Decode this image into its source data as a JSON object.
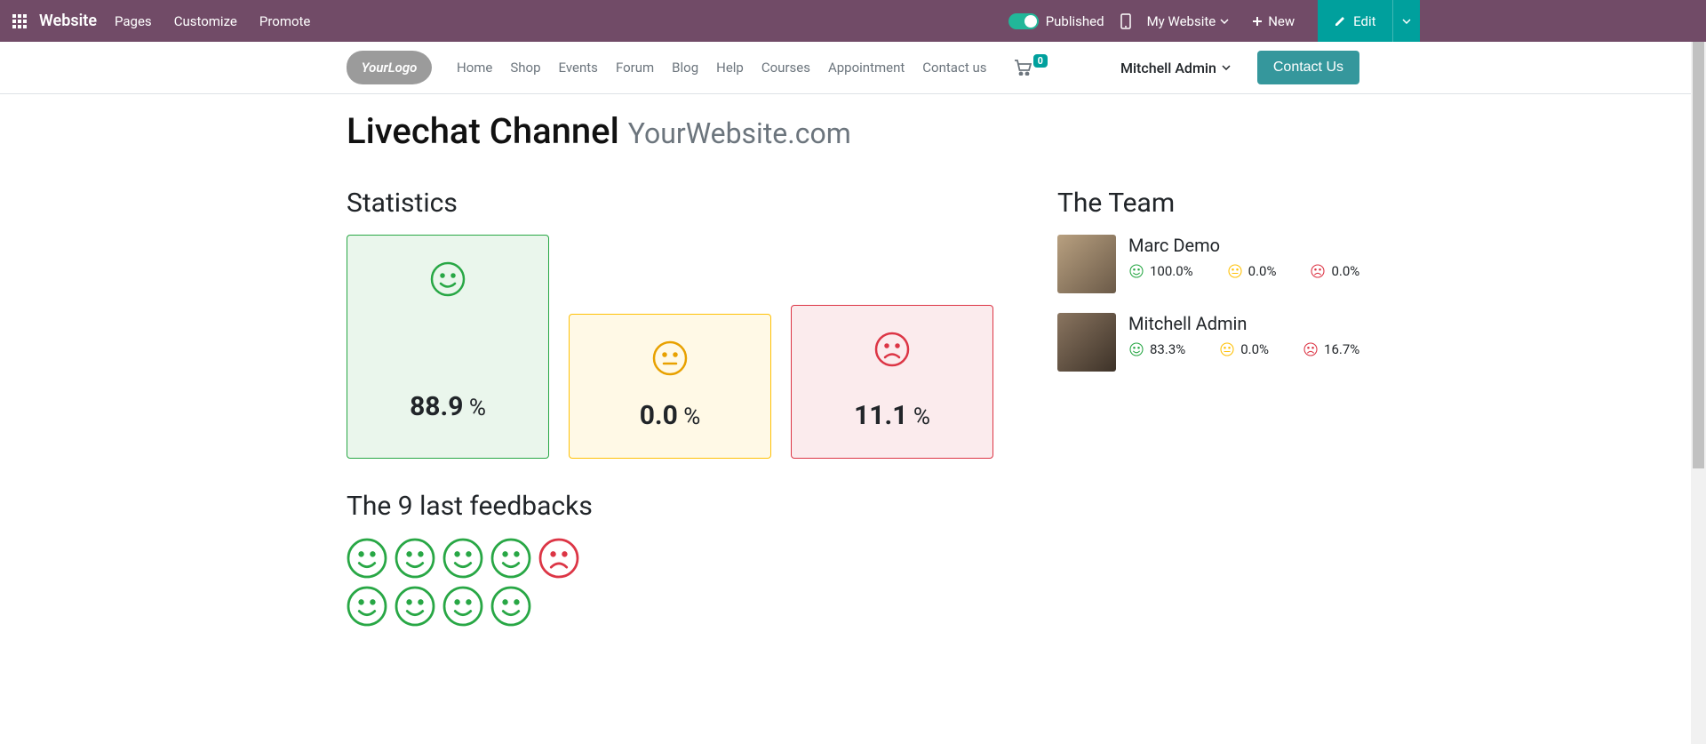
{
  "admin": {
    "brand": "Website",
    "menu": [
      "Pages",
      "Customize",
      "Promote"
    ],
    "published": "Published",
    "my_website": "My Website",
    "new": "New",
    "edit": "Edit"
  },
  "header": {
    "logo_text": "YourLogo",
    "nav": [
      "Home",
      "Shop",
      "Events",
      "Forum",
      "Blog",
      "Help",
      "Courses",
      "Appointment",
      "Contact us"
    ],
    "cart_count": "0",
    "user": "Mitchell Admin",
    "contact_btn": "Contact Us"
  },
  "page": {
    "title": "Livechat Channel",
    "subtitle": "YourWebsite.com",
    "stats_heading": "Statistics",
    "stats": {
      "happy": "88.9",
      "neutral": "0.0",
      "sad": "11.1",
      "pct": " %"
    },
    "feedbacks_heading": "The 9 last feedbacks",
    "feedbacks": [
      "happy",
      "happy",
      "happy",
      "happy",
      "sad",
      "happy",
      "happy",
      "happy",
      "happy"
    ],
    "team_heading": "The Team",
    "team": [
      {
        "name": "Marc Demo",
        "happy": "100.0%",
        "neutral": "0.0%",
        "sad": "0.0%"
      },
      {
        "name": "Mitchell Admin",
        "happy": "83.3%",
        "neutral": "0.0%",
        "sad": "16.7%"
      }
    ]
  }
}
